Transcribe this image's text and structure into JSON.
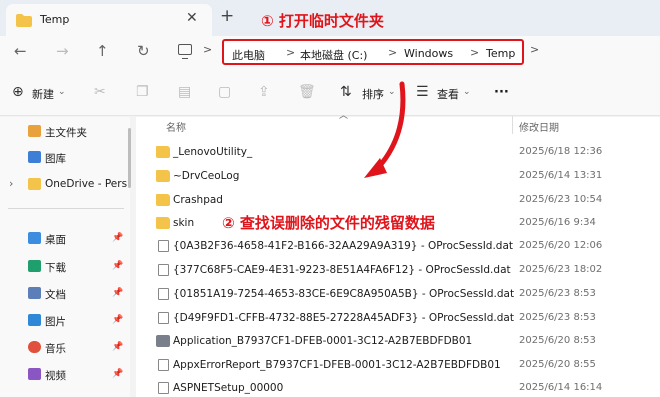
{
  "tab": {
    "title": "Temp",
    "close": "✕",
    "new": "+"
  },
  "annotations": {
    "step1": "① 打开临时文件夹",
    "step2": "② 查找误删除的文件的残留数据"
  },
  "nav": {
    "back": "←",
    "forward": "→",
    "up": "↑",
    "refresh": "↻"
  },
  "breadcrumb": [
    "此电脑",
    "本地磁盘 (C:)",
    "Windows",
    "Temp"
  ],
  "breadcrumb_sep": ">",
  "toolbar": {
    "new": "新建",
    "sort": "排序",
    "view": "查看",
    "more": "···"
  },
  "sidebar": {
    "items": [
      {
        "label": "主文件夹",
        "icon": "home-icon",
        "color": "#e9a23b"
      },
      {
        "label": "图库",
        "icon": "gallery-icon",
        "color": "#3d7fd6"
      },
      {
        "label": "OneDrive - Pers",
        "icon": "folder-icon",
        "color": "#f4c34a"
      },
      {
        "label": "桌面",
        "icon": "desktop-icon",
        "color": "#3c8de0"
      },
      {
        "label": "下载",
        "icon": "download-icon",
        "color": "#1f9e6e"
      },
      {
        "label": "文档",
        "icon": "document-icon",
        "color": "#5d7fb7"
      },
      {
        "label": "图片",
        "icon": "pictures-icon",
        "color": "#2f87d8"
      },
      {
        "label": "音乐",
        "icon": "music-icon",
        "color": "#e1503c"
      },
      {
        "label": "视频",
        "icon": "video-icon",
        "color": "#8a56c4"
      }
    ]
  },
  "columns": {
    "name": "名称",
    "date": "修改日期"
  },
  "files": [
    {
      "name": "_LenovoUtility_",
      "date": "2025/6/18 12:36",
      "type": "folder"
    },
    {
      "name": "~DrvCeoLog",
      "date": "2025/6/14 13:31",
      "type": "folder"
    },
    {
      "name": "Crashpad",
      "date": "2025/6/23 10:54",
      "type": "folder"
    },
    {
      "name": "skin",
      "date": "2025/6/16 9:34",
      "type": "folder"
    },
    {
      "name": "{0A3B2F36-4658-41F2-B166-32AA29A9A319} - OProcSessId.dat",
      "date": "2025/6/20 12:06",
      "type": "file"
    },
    {
      "name": "{377C68F5-CAE9-4E31-9223-8E51A4FA6F12} - OProcSessId.dat",
      "date": "2025/6/23 18:02",
      "type": "file"
    },
    {
      "name": "{01851A19-7254-4653-83CE-6E9C8A950A5B} - OProcSessId.dat",
      "date": "2025/6/23 8:53",
      "type": "file"
    },
    {
      "name": "{D49F9FD1-CFFB-4732-88E5-27228A45ADF3} - OProcSessId.dat",
      "date": "2025/6/23 8:53",
      "type": "file"
    },
    {
      "name": "Application_B7937CF1-DFEB-0001-3C12-A2B7EBDFDB01",
      "date": "2025/6/20 8:53",
      "type": "app"
    },
    {
      "name": "AppxErrorReport_B7937CF1-DFEB-0001-3C12-A2B7EBDFDB01",
      "date": "2025/6/20 8:55",
      "type": "file"
    },
    {
      "name": "ASPNETSetup_00000",
      "date": "2025/6/14 16:14",
      "type": "file"
    }
  ],
  "colors": {
    "annotation": "#e0141b",
    "folder": "#f4c34a"
  }
}
